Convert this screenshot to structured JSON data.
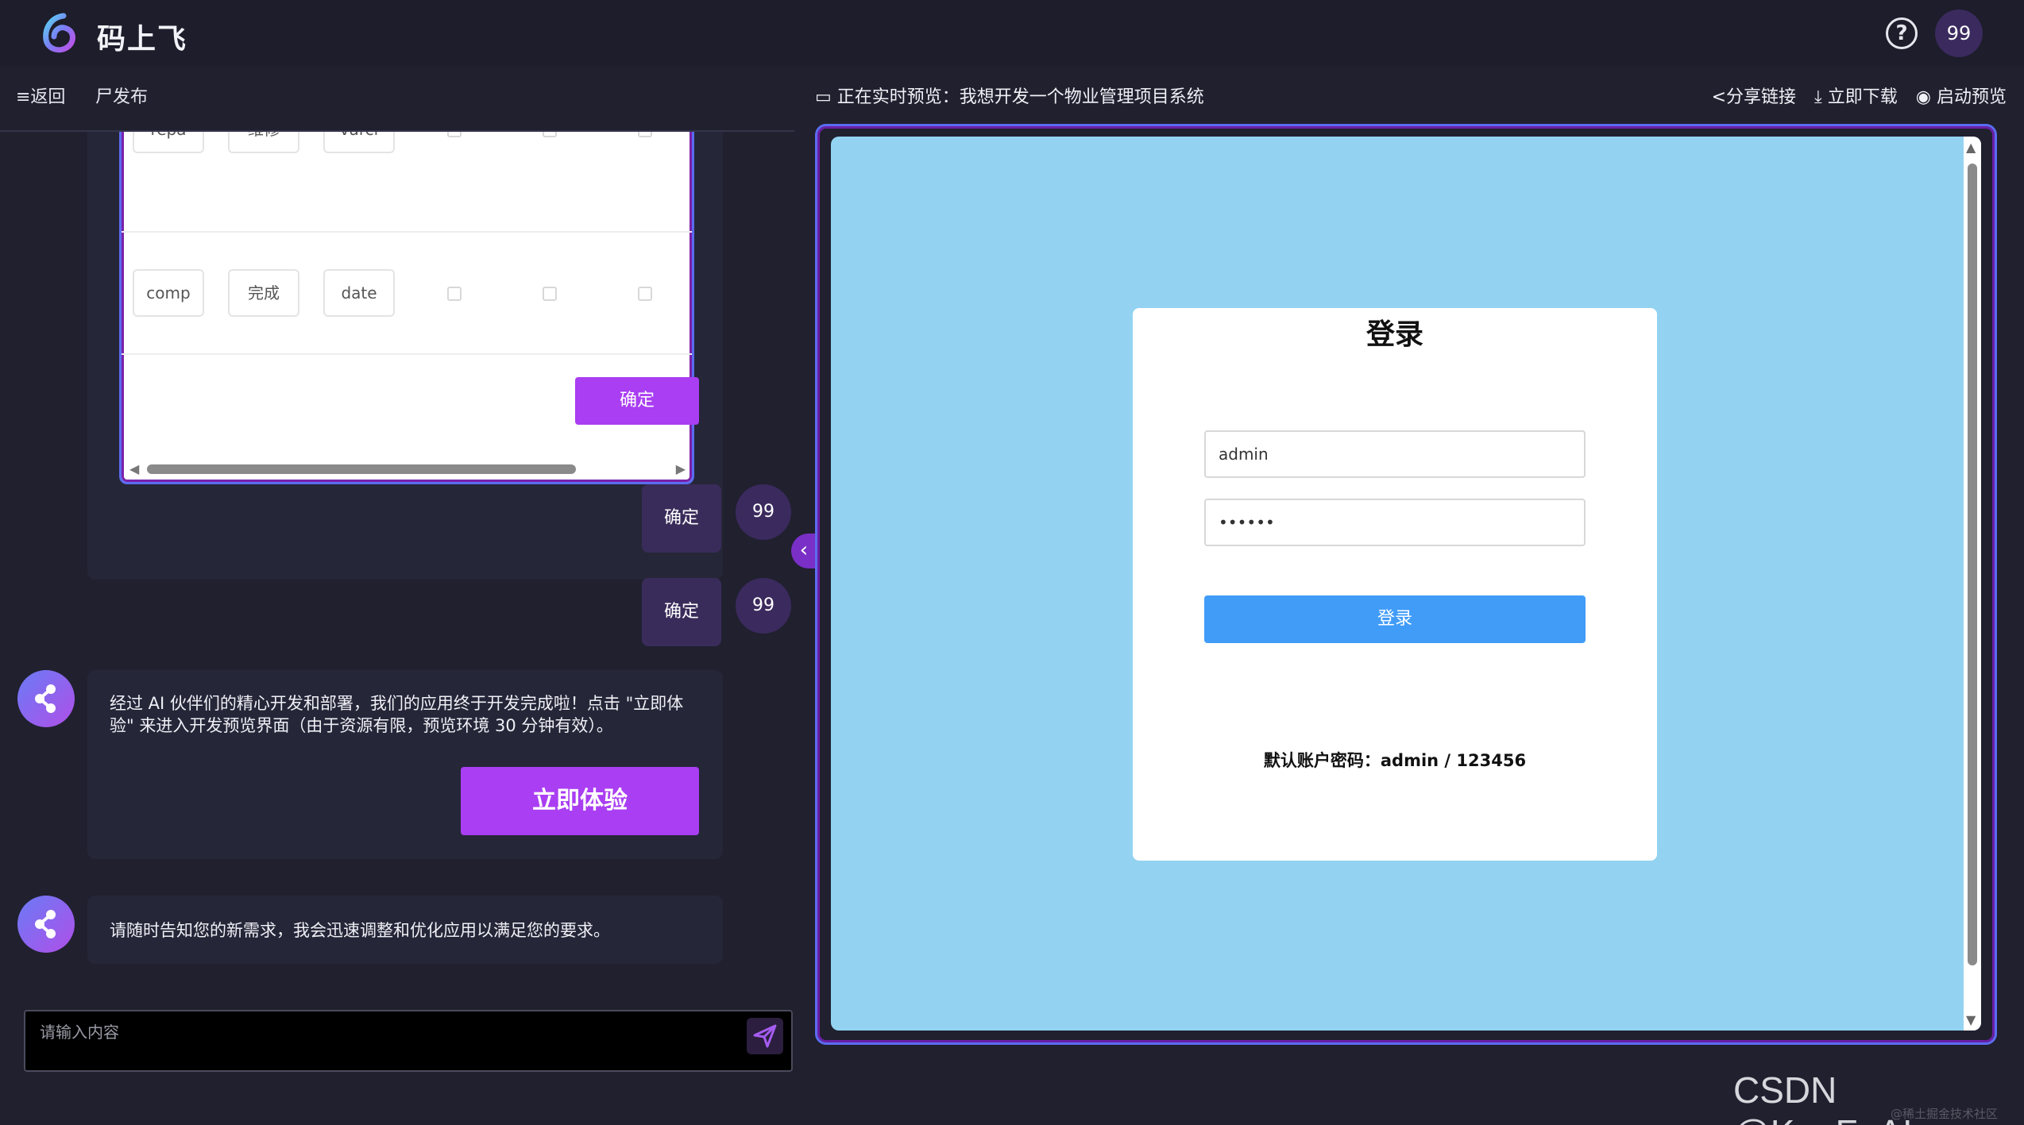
{
  "app": {
    "title": "码上飞",
    "avatar_text": "99",
    "help_symbol": "?"
  },
  "left_toolbar": {
    "back_label": "≡返回",
    "publish_label": "尸发布"
  },
  "table": {
    "rows": [
      {
        "cells": [
          "repa",
          "维修",
          "varcl"
        ]
      },
      {
        "cells": [
          "comp",
          "完成",
          "date"
        ]
      }
    ]
  },
  "chat": {
    "card_confirm_label": "确定",
    "user_messages": [
      {
        "text": "确定",
        "avatar": "99"
      },
      {
        "text": "确定",
        "avatar": "99"
      }
    ],
    "bot_messages": [
      {
        "text": "经过 AI 伙伴们的精心开发和部署，我们的应用终于开发完成啦！点击 \"立即体验\" 来进入开发预览界面（由于资源有限，预览环境 30 分钟有效）。",
        "button": "立即体验"
      },
      {
        "text": "请随时告知您的新需求，我会迅速调整和优化应用以满足您的要求。"
      }
    ],
    "collapse_symbol": "‹",
    "input_placeholder": "请输入内容"
  },
  "preview": {
    "title": "正在实时预览：我想开发一个物业管理项目系统",
    "actions": {
      "share": "分享链接",
      "download": "立即下载",
      "launch": "启动预览"
    },
    "login": {
      "title": "登录",
      "username_value": "admin",
      "password_value": "••••••",
      "button": "登录",
      "hint": "默认账户密码：admin / 123456"
    }
  },
  "watermark": {
    "main": "CSDN @KuaFuAI",
    "small": "@稀土掘金技术社区"
  },
  "colors": {
    "accent_purple": "#a93ef2",
    "preview_bg": "#93d3f1",
    "login_blue": "#419cf8",
    "frame_blue": "#5b6cf0"
  }
}
